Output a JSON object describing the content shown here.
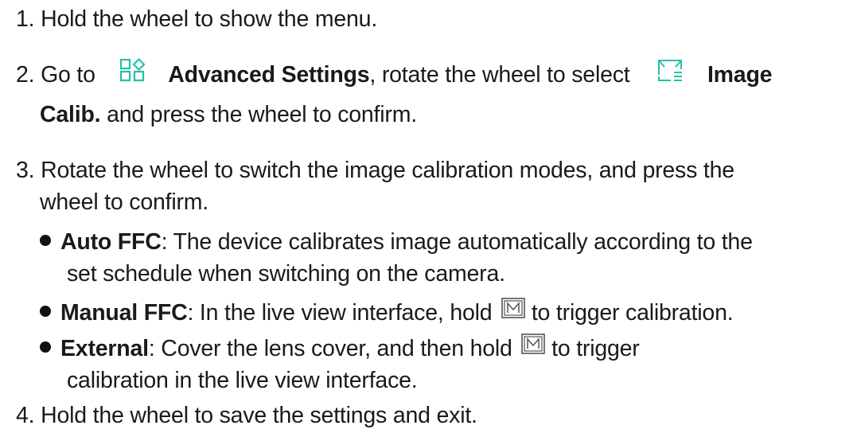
{
  "steps": {
    "s1": {
      "num": "1.",
      "text": "Hold the wheel to show the menu."
    },
    "s2": {
      "num": "2.",
      "go_to": "Go to",
      "advanced_settings": "Advanced Settings",
      "middle": ", rotate the wheel to select",
      "image": "Image",
      "calib": "Calib.",
      "end": " and press the wheel to confirm."
    },
    "s3": {
      "num": "3.",
      "line1": "Rotate the wheel to switch the image calibration modes, and press the",
      "line2": "wheel to confirm.",
      "bullets": [
        {
          "term": "Auto FFC",
          "text": ": The device calibrates image automatically according to the",
          "text2": "set schedule when switching on the camera."
        },
        {
          "term": "Manual FFC",
          "text": ": In the live view interface, hold",
          "after_key": " to trigger calibration."
        },
        {
          "term": "External",
          "text": ": Cover the lens cover, and then hold",
          "after_key": " to trigger",
          "text2": "calibration in the live view interface."
        }
      ]
    },
    "s4": {
      "num": "4.",
      "text": "Hold the wheel to save the settings and exit."
    }
  },
  "icons": {
    "advanced_settings": "advanced-settings-icon",
    "image_calib": "image-calibration-icon",
    "m_key": "m-key-icon",
    "icon_color": "#23c2a3"
  }
}
